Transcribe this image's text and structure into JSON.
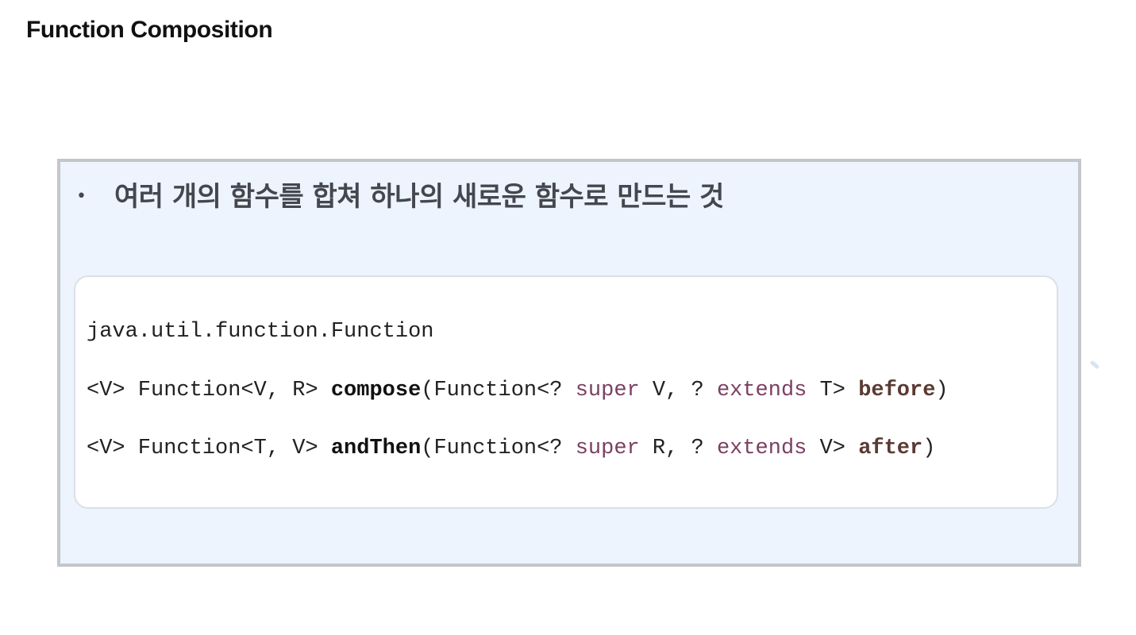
{
  "page": {
    "title": "Function Composition"
  },
  "bullet": {
    "marker": "•",
    "text": "여러 개의 함수를 합쳐 하나의 새로운 함수로 만드는 것"
  },
  "code": {
    "line1": "java.util.function.Function",
    "compose": {
      "prefix": "<V> Function<V, R> ",
      "method": "compose",
      "open": "(Function<? ",
      "super_kw": "super",
      "mid": " V, ? ",
      "extends_kw": "extends",
      "type_end": " T> ",
      "param": "before",
      "close": ")"
    },
    "andThen": {
      "prefix": "<V> Function<T, V> ",
      "method": "andThen",
      "open": "(Function<? ",
      "super_kw": "super",
      "mid": " R, ? ",
      "extends_kw": "extends",
      "type_end": " V> ",
      "param": "after",
      "close": ")"
    }
  },
  "colors": {
    "panel_bg": "#edf4fd",
    "panel_border": "#c3c6ca",
    "keyword": "#7b3f63",
    "param": "#5a3a33",
    "bullet_text": "#44474f"
  }
}
